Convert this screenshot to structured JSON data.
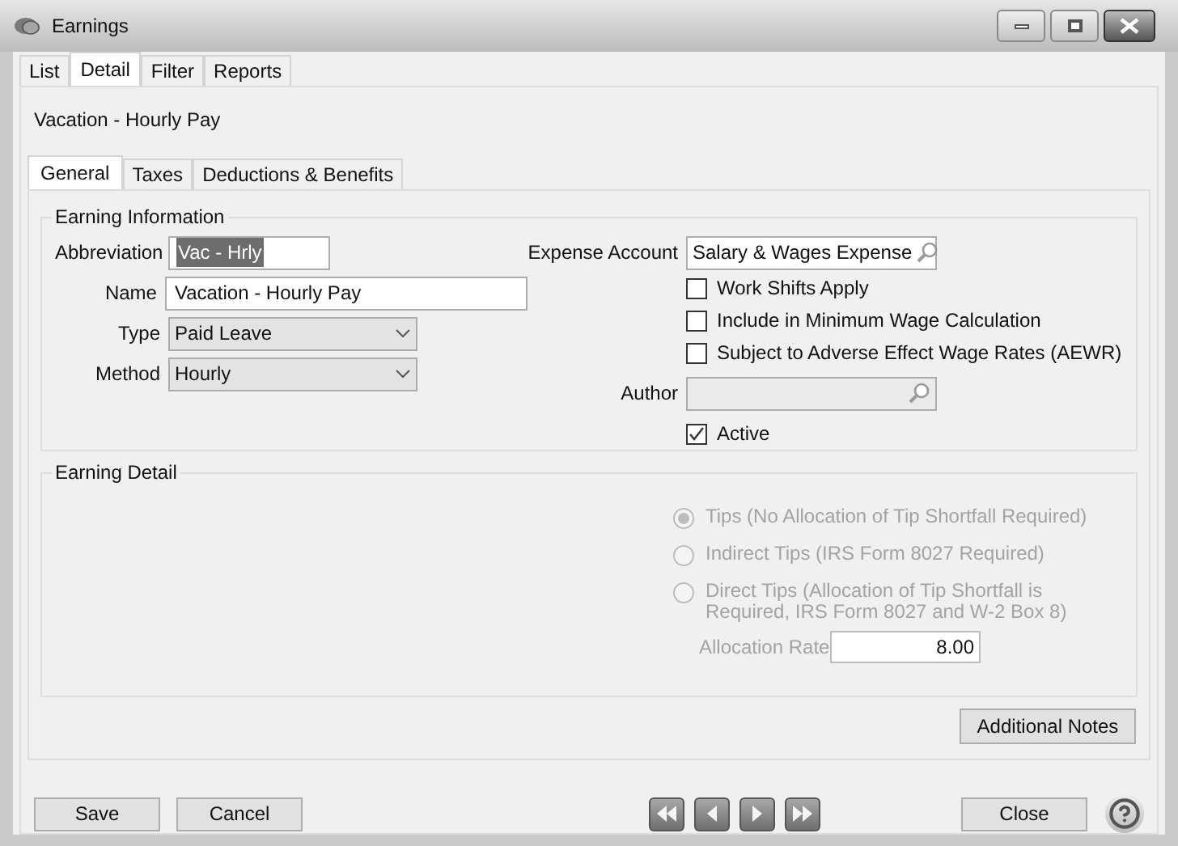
{
  "window": {
    "title": "Earnings"
  },
  "tabs": [
    {
      "label": "List",
      "selected": false
    },
    {
      "label": "Detail",
      "selected": true
    },
    {
      "label": "Filter",
      "selected": false
    },
    {
      "label": "Reports",
      "selected": false
    }
  ],
  "record_title": "Vacation - Hourly Pay",
  "subtabs": [
    {
      "label": "General",
      "selected": true
    },
    {
      "label": "Taxes",
      "selected": false
    },
    {
      "label": "Deductions & Benefits",
      "selected": false
    }
  ],
  "earning_information": {
    "title": "Earning Information",
    "fields": [
      {
        "label": "Abbreviation",
        "value": "Vac - Hrly",
        "kind": "text",
        "highlighted": true
      },
      {
        "label": "Name",
        "value": "Vacation - Hourly Pay",
        "kind": "text"
      },
      {
        "label": "Type",
        "value": "Paid Leave",
        "kind": "dropdown"
      },
      {
        "label": "Method",
        "value": "Hourly",
        "kind": "dropdown"
      }
    ],
    "expense_account": {
      "label": "Expense Account",
      "value": "Salary & Wages Expense"
    },
    "options": [
      {
        "label": "Work Shifts Apply",
        "checked": false
      },
      {
        "label": "Include in Minimum Wage Calculation",
        "checked": false
      },
      {
        "label": "Subject to Adverse Effect Wage Rates (AEWR)",
        "checked": false
      }
    ],
    "author": {
      "label": "Author",
      "disabled": true
    },
    "active": {
      "label": "Active",
      "checked": true
    }
  },
  "earning_detail": {
    "title": "Earning Detail",
    "tip_options": [
      {
        "label": "Tips (No Allocation of Tip Shortfall Required)",
        "selected": true,
        "disabled": true
      },
      {
        "label": "Indirect Tips (IRS Form 8027 Required)",
        "selected": false,
        "disabled": true
      },
      {
        "label": "Direct Tips (Allocation of Tip Shortfall is Required, IRS Form 8027 and W-2 Box 8)",
        "selected": false,
        "disabled": true
      }
    ],
    "allocation_rate": {
      "label": "Allocation Rate",
      "value": "8.00",
      "disabled": true
    }
  },
  "additional_notes_button": "Additional Notes",
  "footer": {
    "save": "Save",
    "cancel": "Cancel",
    "close": "Close"
  }
}
